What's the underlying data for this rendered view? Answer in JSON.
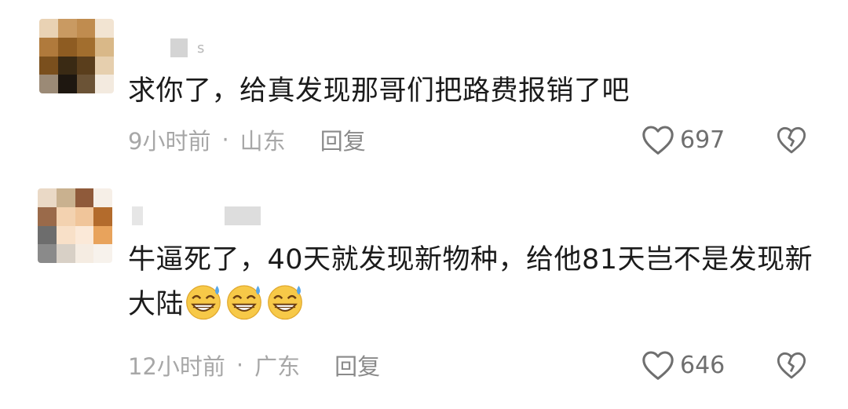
{
  "comments": [
    {
      "username": "",
      "username_suffix": "s",
      "text": "求你了，给真发现那哥们把路费报销了吧",
      "time": "9小时前",
      "separator": "·",
      "location": "山东",
      "reply_label": "回复",
      "like_count": "697",
      "emojis": []
    },
    {
      "username": "",
      "username_suffix": "",
      "text": "牛逼死了，40天就发现新物种，给他81天岂不是发现新大陆",
      "time": "12小时前",
      "separator": "·",
      "location": "广东",
      "reply_label": "回复",
      "like_count": "646",
      "emojis": [
        "grinning-sweat-emoji",
        "grinning-sweat-emoji",
        "grinning-sweat-emoji"
      ]
    }
  ],
  "colors": {
    "text": "#1b1b1b",
    "meta": "#a7a7a7",
    "icon": "#6f6f6f",
    "emoji_face": "#f7c948",
    "emoji_sweat": "#5aa7e8"
  },
  "icons": {
    "like": "heart-outline-icon",
    "dislike": "broken-heart-icon"
  }
}
